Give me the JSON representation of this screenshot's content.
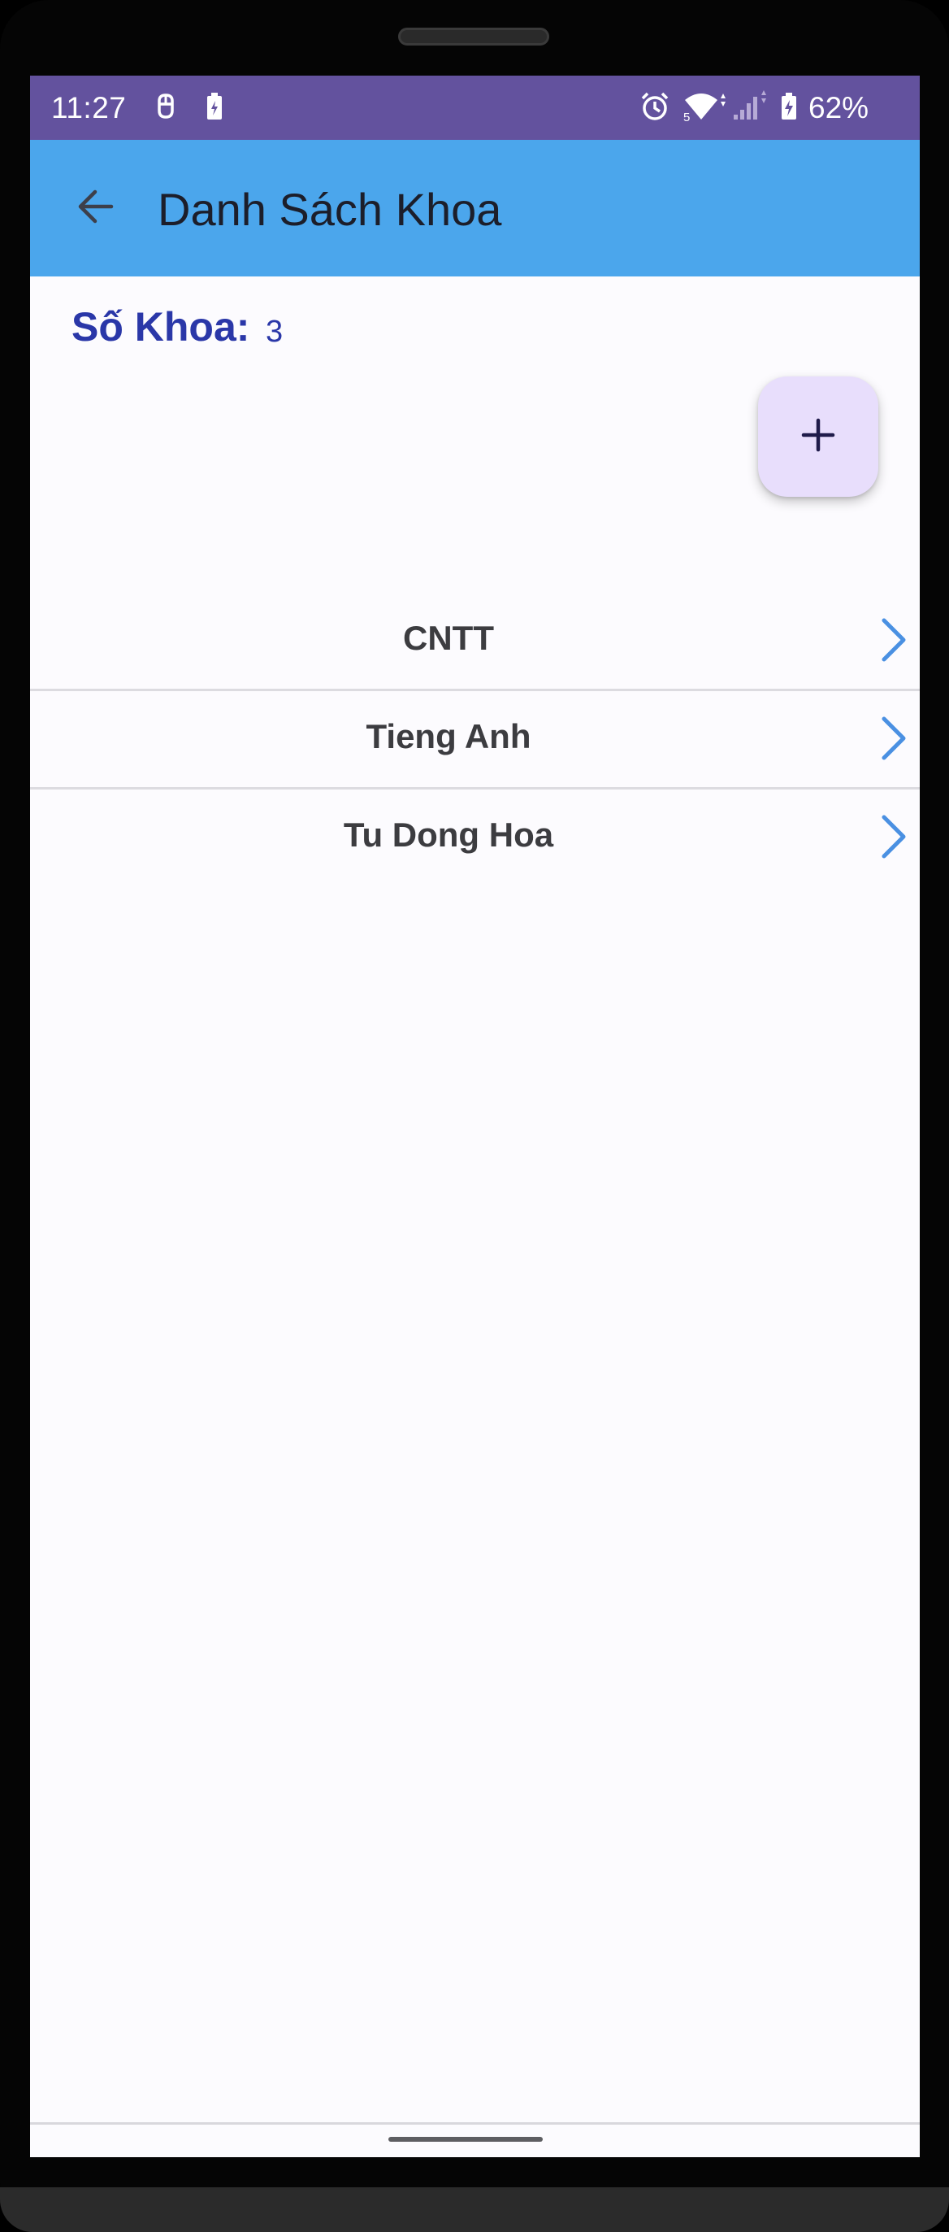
{
  "status_bar": {
    "time": "11:27",
    "battery_percent": "62%",
    "icons": [
      "notification-icon",
      "battery-saver-icon",
      "alarm-icon",
      "wifi-icon",
      "signal-icon",
      "battery-icon"
    ]
  },
  "app_bar": {
    "title": "Danh Sách Khoa",
    "back_icon": "arrow-back-icon"
  },
  "summary": {
    "label": "Số Khoa:",
    "value": "3"
  },
  "fab": {
    "label": "+",
    "icon": "add-icon"
  },
  "departments": [
    {
      "name": "CNTT"
    },
    {
      "name": "Tieng Anh"
    },
    {
      "name": "Tu Dong Hoa"
    }
  ],
  "colors": {
    "status_bar": "#63529e",
    "app_bar": "#4ba6ec",
    "accent_text": "#2a37a8",
    "chevron": "#4a90e2",
    "fab_bg": "#e8defc"
  }
}
